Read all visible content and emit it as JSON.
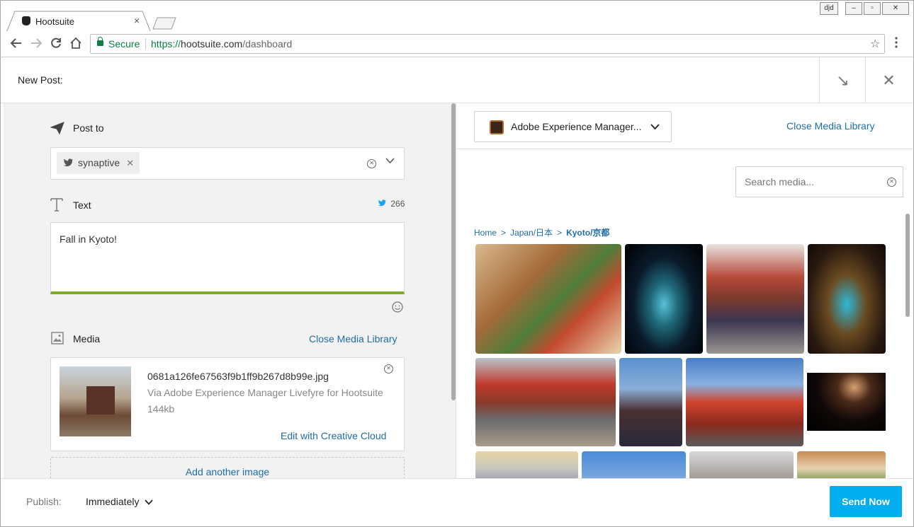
{
  "browser": {
    "tab_title": "Hootsuite",
    "tab_close": "×",
    "secure_label": "Secure",
    "url_scheme": "https://",
    "url_host": "hootsuite.com",
    "url_path": "/dashboard",
    "user_badge": "djd",
    "icons": [
      "back-icon",
      "forward-icon",
      "reload-icon",
      "home-icon",
      "lock-icon",
      "star-icon",
      "menu-icon"
    ]
  },
  "header": {
    "title": "New Post:",
    "minimize_glyph": "↘",
    "close_glyph": "✕"
  },
  "compose": {
    "post_to_label": "Post to",
    "profile_chip": "synaptive",
    "text_label": "Text",
    "char_count": "266",
    "text_value": "Fall in Kyoto!",
    "media_label": "Media",
    "close_media_library": "Close Media Library",
    "media_item": {
      "filename": "0681a126fe67563f9b1ff9b267d8b99e.jpg",
      "source": "Via Adobe Experience Manager Livefyre for Hootsuite",
      "size": "144kb",
      "edit_label": "Edit with Creative Cloud"
    },
    "add_another": "Add another image"
  },
  "library": {
    "source_name": "Adobe Experience Manager...",
    "close_label": "Close Media Library",
    "search_placeholder": "Search media...",
    "breadcrumb": [
      "Home",
      "Japan/日本",
      "Kyoto/京都"
    ],
    "breadcrumb_sep": ">"
  },
  "footer": {
    "publish_label": "Publish:",
    "publish_value": "Immediately",
    "send_label": "Send Now"
  },
  "colors": {
    "accent": "#00aeef",
    "link": "#1f6ea8",
    "progress": "#7cab2f",
    "secure": "#0b8043"
  }
}
